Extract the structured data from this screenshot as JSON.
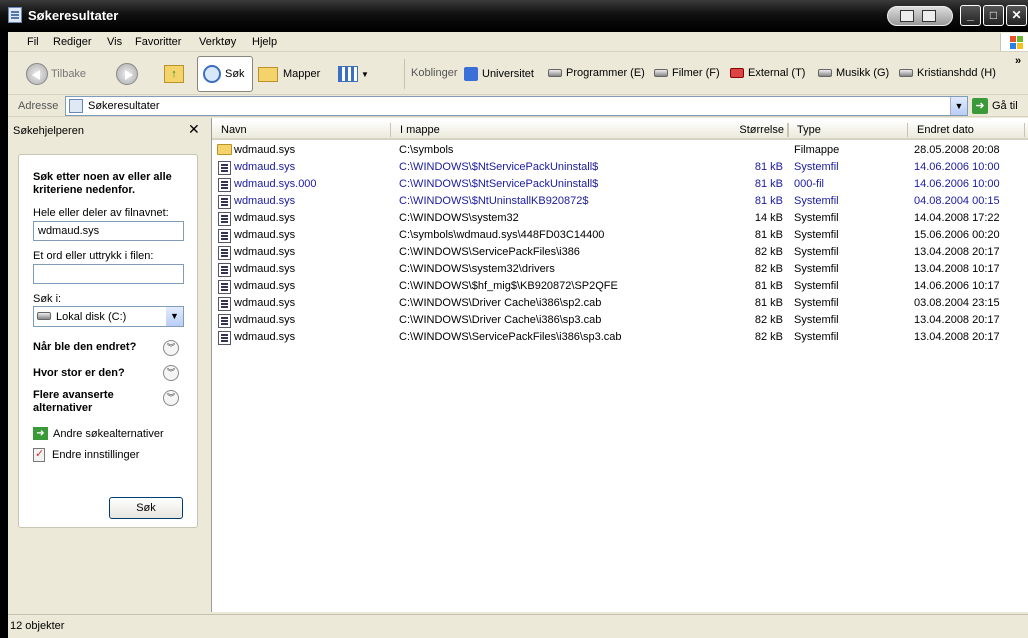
{
  "window": {
    "title": "Søkeresultater"
  },
  "menu": [
    "Fil",
    "Rediger",
    "Vis",
    "Favoritter",
    "Verktøy",
    "Hjelp"
  ],
  "toolbar": {
    "back": "Tilbake",
    "search": "Søk",
    "folders": "Mapper",
    "links_label": "Koblinger",
    "links": [
      {
        "label": "Universitet",
        "icon": "globe-icon"
      },
      {
        "label": "Programmer (E)",
        "icon": "drive-icon"
      },
      {
        "label": "Filmer (F)",
        "icon": "drive-icon"
      },
      {
        "label": "External (T)",
        "icon": "external-drive-icon"
      },
      {
        "label": "Musikk (G)",
        "icon": "drive-icon"
      },
      {
        "label": "Kristianshdd (H)",
        "icon": "drive-icon"
      }
    ],
    "more": "»"
  },
  "address": {
    "label": "Adresse",
    "value": "Søkeresultater",
    "go": "Gå til"
  },
  "search_pane": {
    "title": "Søkehjelperen",
    "intro": "Søk etter noen av eller alle kriteriene nedenfor.",
    "filename_label": "Hele eller deler av filnavnet:",
    "filename_value": "wdmaud.sys",
    "phrase_label": "Et ord eller uttrykk i filen:",
    "phrase_value": "",
    "lookin_label": "Søk i:",
    "lookin_value": "Lokal disk (C:)",
    "when_modified": "Når ble den endret?",
    "size": "Hvor stor er den?",
    "advanced": "Flere avanserte alternativer",
    "other_options": "Andre søkealternativer",
    "change_prefs": "Endre innstillinger",
    "search_button": "Søk"
  },
  "columns": {
    "name": "Navn",
    "folder": "I mappe",
    "size": "Størrelse",
    "type": "Type",
    "modified": "Endret dato"
  },
  "files": [
    {
      "name": "wdmaud.sys",
      "folder": "C:\\symbols",
      "size": "",
      "type": "Filmappe",
      "modified": "28.05.2008 20:08",
      "kind": "folder",
      "blue": false
    },
    {
      "name": "wdmaud.sys",
      "folder": "C:\\WINDOWS\\$NtServicePackUninstall$",
      "size": "81 kB",
      "type": "Systemfil",
      "modified": "14.06.2006 10:00",
      "kind": "file",
      "blue": true
    },
    {
      "name": "wdmaud.sys.000",
      "folder": "C:\\WINDOWS\\$NtServicePackUninstall$",
      "size": "81 kB",
      "type": "000-fil",
      "modified": "14.06.2006 10:00",
      "kind": "file",
      "blue": true
    },
    {
      "name": "wdmaud.sys",
      "folder": "C:\\WINDOWS\\$NtUninstallKB920872$",
      "size": "81 kB",
      "type": "Systemfil",
      "modified": "04.08.2004 00:15",
      "kind": "file",
      "blue": true
    },
    {
      "name": "wdmaud.sys",
      "folder": "C:\\WINDOWS\\system32",
      "size": "14 kB",
      "type": "Systemfil",
      "modified": "14.04.2008 17:22",
      "kind": "file",
      "blue": false
    },
    {
      "name": "wdmaud.sys",
      "folder": "C:\\symbols\\wdmaud.sys\\448FD03C14400",
      "size": "81 kB",
      "type": "Systemfil",
      "modified": "15.06.2006 00:20",
      "kind": "file",
      "blue": false
    },
    {
      "name": "wdmaud.sys",
      "folder": "C:\\WINDOWS\\ServicePackFiles\\i386",
      "size": "82 kB",
      "type": "Systemfil",
      "modified": "13.04.2008 20:17",
      "kind": "file",
      "blue": false
    },
    {
      "name": "wdmaud.sys",
      "folder": "C:\\WINDOWS\\system32\\drivers",
      "size": "82 kB",
      "type": "Systemfil",
      "modified": "13.04.2008 10:17",
      "kind": "file",
      "blue": false
    },
    {
      "name": "wdmaud.sys",
      "folder": "C:\\WINDOWS\\$hf_mig$\\KB920872\\SP2QFE",
      "size": "81 kB",
      "type": "Systemfil",
      "modified": "14.06.2006 10:17",
      "kind": "file",
      "blue": false
    },
    {
      "name": "wdmaud.sys",
      "folder": "C:\\WINDOWS\\Driver Cache\\i386\\sp2.cab",
      "size": "81 kB",
      "type": "Systemfil",
      "modified": "03.08.2004 23:15",
      "kind": "file",
      "blue": false
    },
    {
      "name": "wdmaud.sys",
      "folder": "C:\\WINDOWS\\Driver Cache\\i386\\sp3.cab",
      "size": "82 kB",
      "type": "Systemfil",
      "modified": "13.04.2008 20:17",
      "kind": "file",
      "blue": false
    },
    {
      "name": "wdmaud.sys",
      "folder": "C:\\WINDOWS\\ServicePackFiles\\i386\\sp3.cab",
      "size": "82 kB",
      "type": "Systemfil",
      "modified": "13.04.2008 20:17",
      "kind": "file",
      "blue": false
    }
  ],
  "status": {
    "text": "12 objekter"
  },
  "colors": {
    "accent_blue": "#1a1aa0",
    "titlebar": "#000000",
    "pane_bg": "#ece9d8"
  }
}
